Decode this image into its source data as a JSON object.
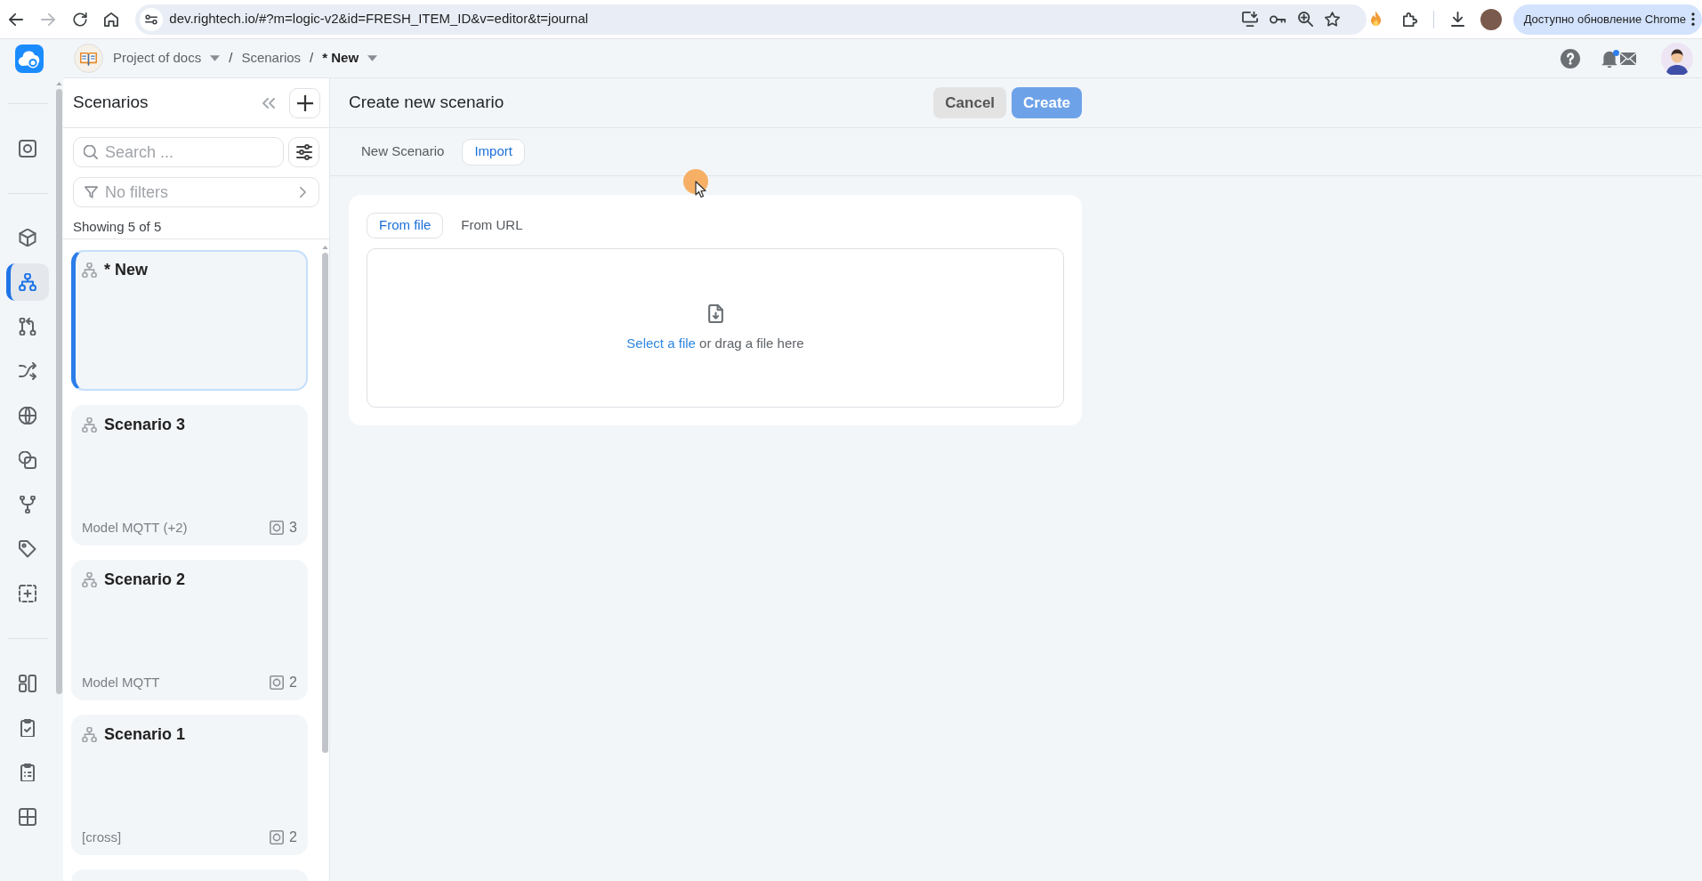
{
  "browser": {
    "nav": [
      {
        "kind": "back",
        "disabled": false
      },
      {
        "kind": "forward",
        "disabled": true
      },
      {
        "kind": "reload",
        "disabled": false
      },
      {
        "kind": "home",
        "disabled": false
      }
    ],
    "url": "dev.rightech.io/#?m=logic-v2&id=FRESH_ITEM_ID&v=editor&t=journal",
    "update_button": "Доступно обновление Chrome"
  },
  "app_header": {
    "breadcrumbs": [
      {
        "kind": "crumb",
        "label": "Project of docs",
        "caret": true,
        "current": false
      },
      {
        "kind": "separator",
        "label": "/"
      },
      {
        "kind": "crumb",
        "label": "Scenarios",
        "caret": false,
        "current": false
      },
      {
        "kind": "separator",
        "label": "/"
      },
      {
        "kind": "crumb",
        "label": "* New",
        "caret": true,
        "current": true
      }
    ],
    "bell_unread": true
  },
  "rail": {
    "groups": [
      {
        "items": [
          {
            "selected": false
          }
        ]
      },
      {
        "items": [
          {
            "selected": false
          },
          {
            "selected": true
          },
          {
            "selected": false
          },
          {
            "selected": false
          },
          {
            "selected": false
          },
          {
            "selected": false
          },
          {
            "selected": false
          },
          {
            "selected": false
          },
          {
            "selected": false
          }
        ]
      },
      {
        "items": [
          {
            "selected": false
          },
          {
            "selected": false
          },
          {
            "selected": false
          },
          {
            "selected": false
          }
        ]
      }
    ]
  },
  "sidebar": {
    "title": "Scenarios",
    "search": {
      "placeholder": "Search ..."
    },
    "filter": {
      "label": "No filters"
    },
    "count": "Showing 5 of 5",
    "cards": [
      {
        "title": "* New",
        "selected": true
      },
      {
        "title": "Scenario 3",
        "selected": false,
        "model": "Model MQTT (+2)",
        "objects": "3"
      },
      {
        "title": "Scenario 2",
        "selected": false,
        "model": "Model MQTT",
        "objects": "2"
      },
      {
        "title": "Scenario 1",
        "selected": false,
        "model": "[cross]",
        "objects": "2"
      },
      {
        "selected": false
      }
    ]
  },
  "main": {
    "title": "Create new scenario",
    "actions": [
      {
        "label": "Cancel",
        "kind": "secondary",
        "disabled": false
      },
      {
        "label": "Create",
        "kind": "primary",
        "disabled": true
      }
    ],
    "tabs": [
      {
        "label": "New Scenario",
        "selected": false
      },
      {
        "label": "Import",
        "selected": true
      }
    ],
    "source_tabs": [
      {
        "label": "From file",
        "selected": true
      },
      {
        "label": "From URL",
        "selected": false
      }
    ],
    "dropzone": {
      "link": "Select a file",
      "text": "or drag a file here"
    }
  }
}
